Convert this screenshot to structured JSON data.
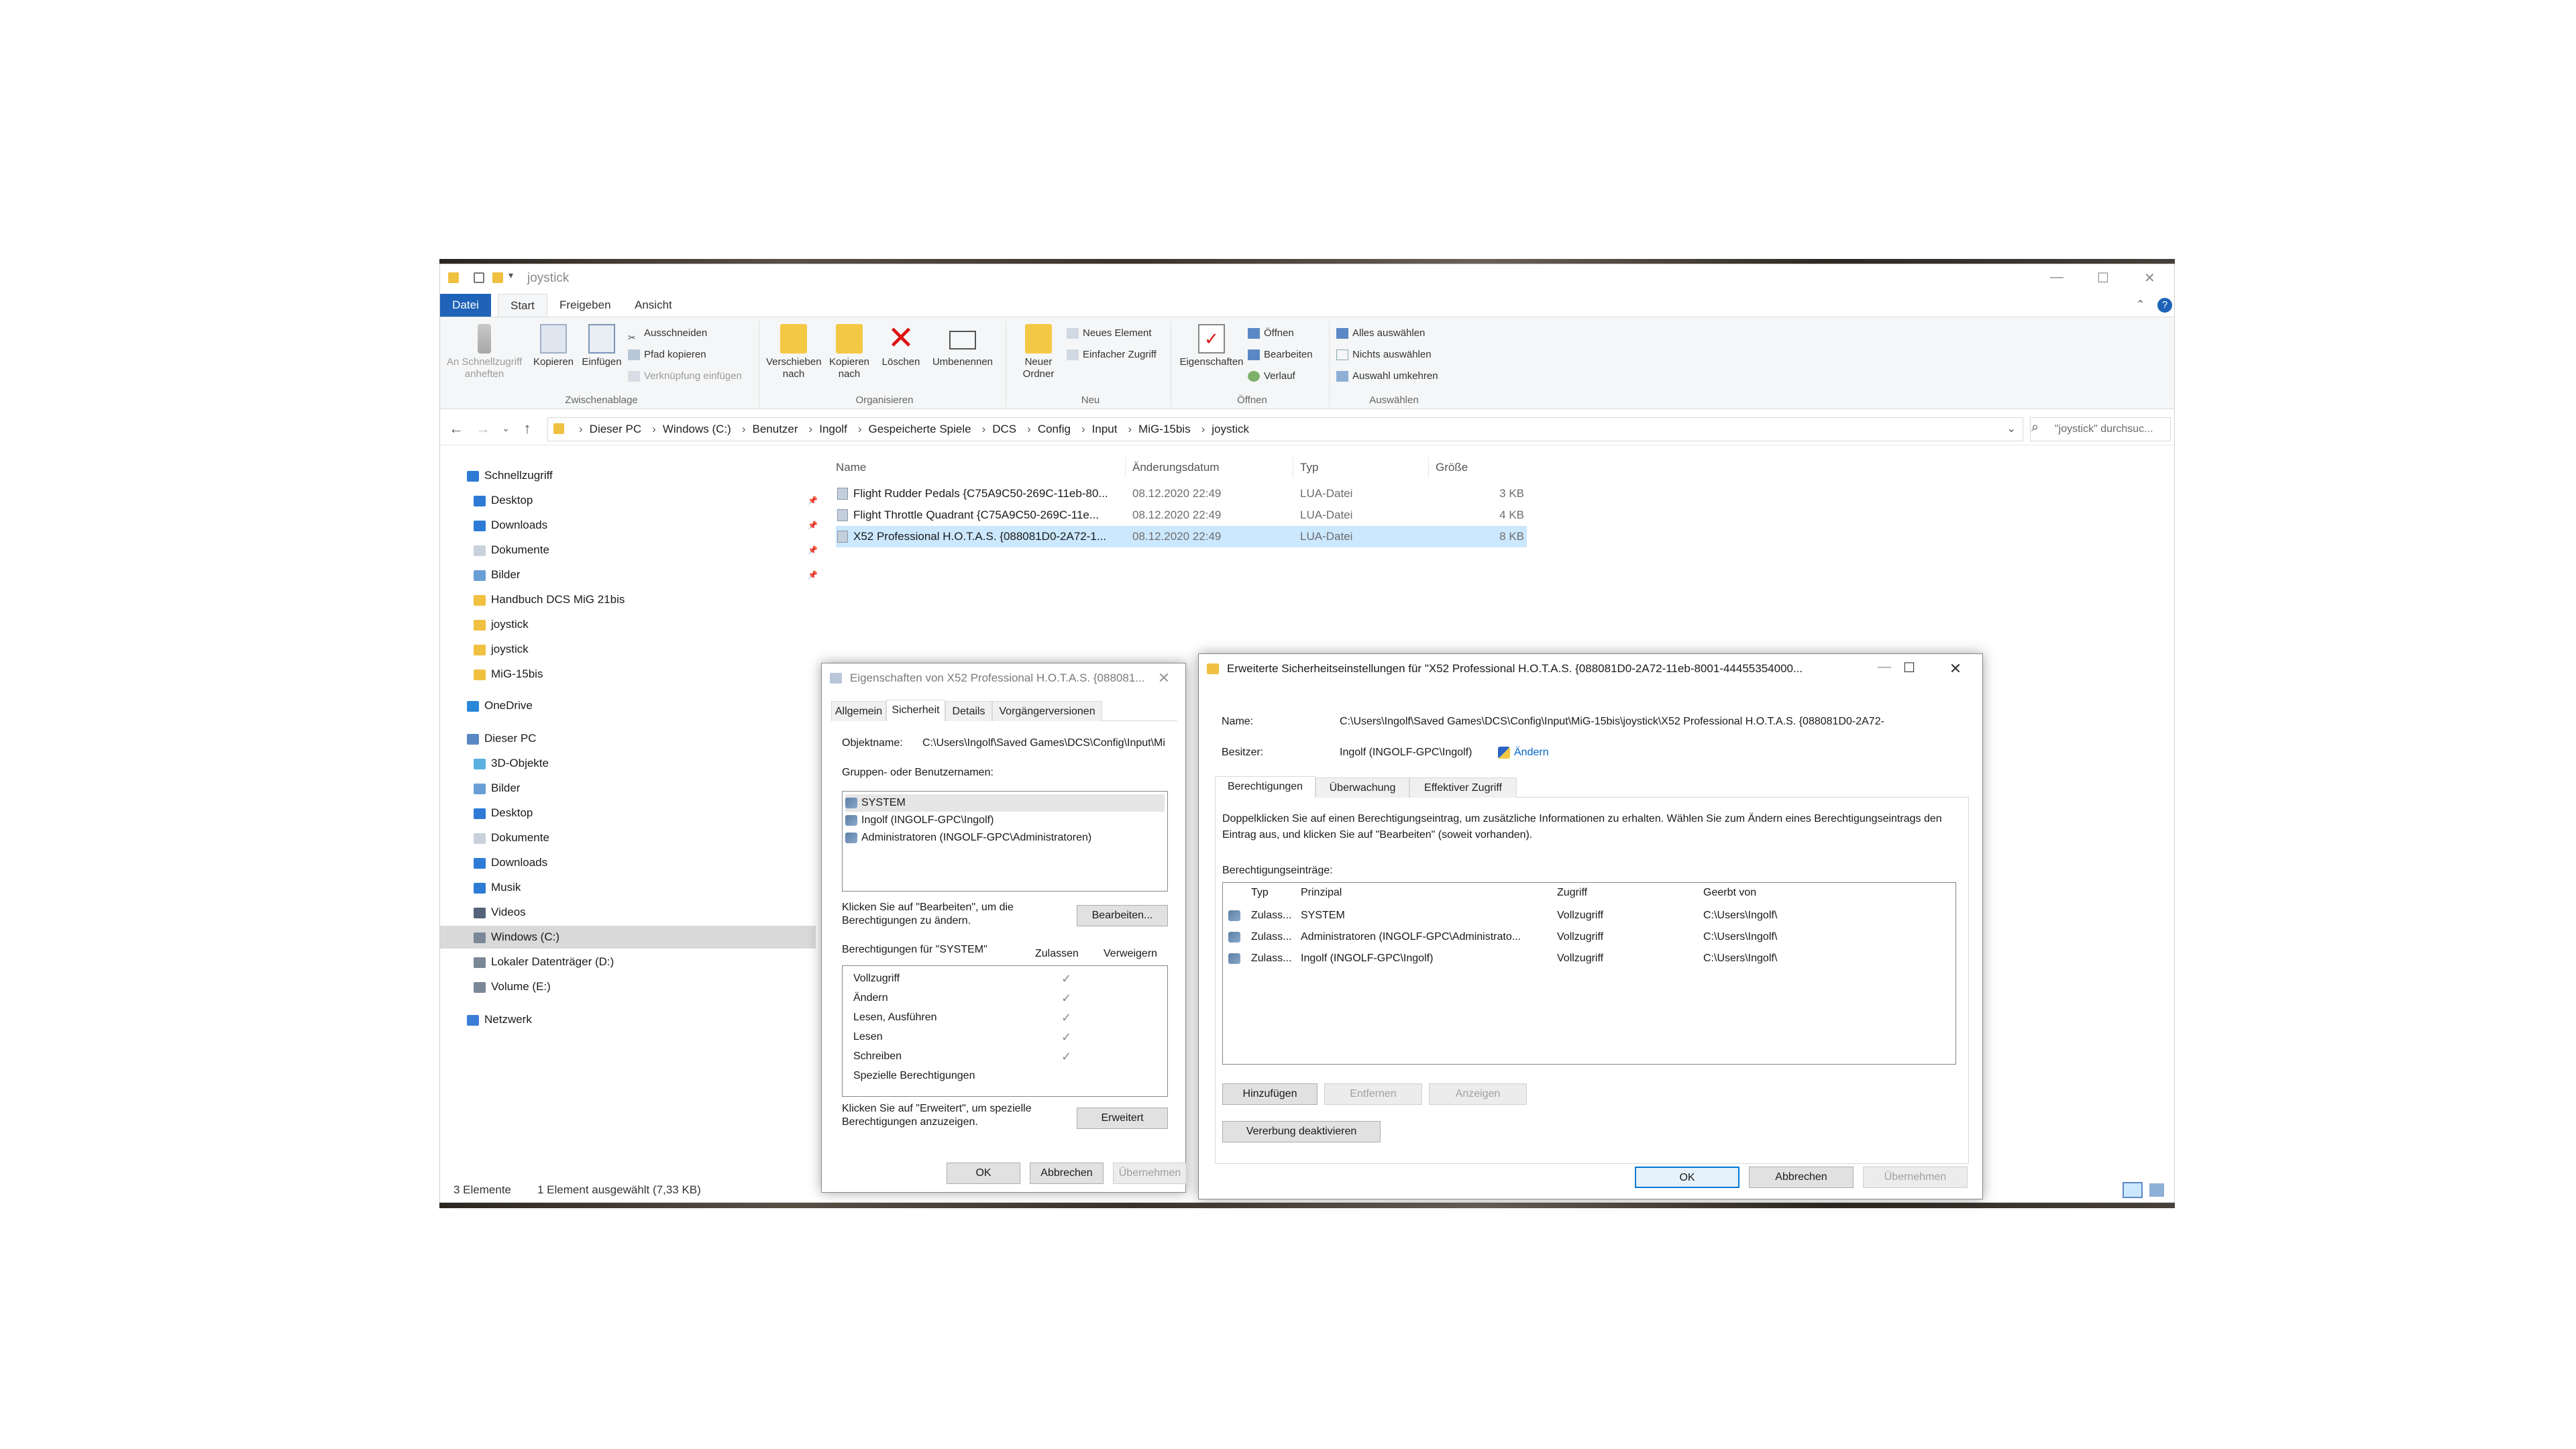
{
  "explorer": {
    "title": "joystick",
    "window_controls": [
      "—",
      "☐",
      "✕"
    ],
    "ribbon_tabs": [
      "Datei",
      "Start",
      "Freigeben",
      "Ansicht"
    ],
    "ribbon": {
      "zwischenablage": {
        "label": "Zwischenablage",
        "pin": "An Schnellzugriff anheften",
        "copy": "Kopieren",
        "paste": "Einfügen",
        "cut": "Ausschneiden",
        "copy_path": "Pfad kopieren",
        "paste_link": "Verknüpfung einfügen"
      },
      "organisieren": {
        "label": "Organisieren",
        "move": "Verschieben nach",
        "copy_to": "Kopieren nach",
        "delete": "Löschen",
        "rename": "Umbenennen"
      },
      "neu": {
        "label": "Neu",
        "new_folder": "Neuer Ordner",
        "new_item": "Neues Element",
        "easy_access": "Einfacher Zugriff"
      },
      "oeffnen": {
        "label": "Öffnen",
        "properties": "Eigenschaften",
        "open": "Öffnen",
        "edit": "Bearbeiten",
        "history": "Verlauf"
      },
      "auswaehlen": {
        "label": "Auswählen",
        "select_all": "Alles auswählen",
        "select_none": "Nichts auswählen",
        "invert": "Auswahl umkehren"
      }
    },
    "breadcrumb": [
      "Dieser PC",
      "Windows (C:)",
      "Benutzer",
      "Ingolf",
      "Gespeicherte Spiele",
      "DCS",
      "Config",
      "Input",
      "MiG-15bis",
      "joystick"
    ],
    "search_placeholder": "\"joystick\" durchsuc...",
    "nav": {
      "quick_access": "Schnellzugriff",
      "quick_items": [
        "Desktop",
        "Downloads",
        "Dokumente",
        "Bilder",
        "Handbuch DCS MiG 21bis",
        "joystick",
        "joystick",
        "MiG-15bis"
      ],
      "onedrive": "OneDrive",
      "this_pc": "Dieser PC",
      "pc_items": [
        "3D-Objekte",
        "Bilder",
        "Desktop",
        "Dokumente",
        "Downloads",
        "Musik",
        "Videos",
        "Windows (C:)",
        "Lokaler Datenträger (D:)",
        "Volume (E:)"
      ],
      "network": "Netzwerk"
    },
    "columns": [
      "Name",
      "Änderungsdatum",
      "Typ",
      "Größe"
    ],
    "files": [
      {
        "name": "Flight Rudder Pedals {C75A9C50-269C-11eb-80...",
        "date": "08.12.2020 22:49",
        "type": "LUA-Datei",
        "size": "3 KB"
      },
      {
        "name": "Flight Throttle Quadrant {C75A9C50-269C-11e...",
        "date": "08.12.2020 22:49",
        "type": "LUA-Datei",
        "size": "4 KB"
      },
      {
        "name": "X52 Professional H.O.T.A.S. {088081D0-2A72-1...",
        "date": "08.12.2020 22:49",
        "type": "LUA-Datei",
        "size": "8 KB"
      }
    ],
    "status": {
      "count": "3 Elemente",
      "selected": "1 Element ausgewählt (7,33 KB)"
    }
  },
  "props_dialog": {
    "title": "Eigenschaften von X52 Professional H.O.T.A.S. {088081...",
    "tabs": [
      "Allgemein",
      "Sicherheit",
      "Details",
      "Vorgängerversionen"
    ],
    "object_label": "Objektname:",
    "object_value": "C:\\Users\\Ingolf\\Saved Games\\DCS\\Config\\Input\\Mi",
    "groups_label": "Gruppen- oder Benutzernamen:",
    "groups": [
      "SYSTEM",
      "Ingolf (INGOLF-GPC\\Ingolf)",
      "Administratoren (INGOLF-GPC\\Administratoren)"
    ],
    "edit_hint": "Klicken Sie auf \"Bearbeiten\", um die Berechtigungen zu ändern.",
    "edit_button": "Bearbeiten...",
    "perms_for": "Berechtigungen für \"SYSTEM\"",
    "allow": "Zulassen",
    "deny": "Verweigern",
    "perms": [
      {
        "name": "Vollzugriff",
        "allow": true
      },
      {
        "name": "Ändern",
        "allow": true
      },
      {
        "name": "Lesen, Ausführen",
        "allow": true
      },
      {
        "name": "Lesen",
        "allow": true
      },
      {
        "name": "Schreiben",
        "allow": true
      },
      {
        "name": "Spezielle Berechtigungen",
        "allow": false
      }
    ],
    "advanced_hint": "Klicken Sie auf \"Erweitert\", um spezielle Berechtigungen anzuzeigen.",
    "advanced_button": "Erweitert",
    "ok": "OK",
    "cancel": "Abbrechen",
    "apply": "Übernehmen"
  },
  "adv_dialog": {
    "title": "Erweiterte Sicherheitseinstellungen für \"X52 Professional H.O.T.A.S. {088081D0-2A72-11eb-8001-44455354000...",
    "name_label": "Name:",
    "name_value": "C:\\Users\\Ingolf\\Saved Games\\DCS\\Config\\Input\\MiG-15bis\\joystick\\X52 Professional H.O.T.A.S. {088081D0-2A72-",
    "owner_label": "Besitzer:",
    "owner_value": "Ingolf (INGOLF-GPC\\Ingolf)",
    "owner_change": "Ändern",
    "tabs": [
      "Berechtigungen",
      "Überwachung",
      "Effektiver Zugriff"
    ],
    "info": "Doppelklicken Sie auf einen Berechtigungseintrag, um zusätzliche Informationen zu erhalten. Wählen Sie zum Ändern eines Berechtigungseintrags den Eintrag aus, und klicken Sie auf \"Bearbeiten\" (soweit vorhanden).",
    "entries_label": "Berechtigungseinträge:",
    "columns": [
      "Typ",
      "Prinzipal",
      "Zugriff",
      "Geerbt von"
    ],
    "entries": [
      {
        "type": "Zulass...",
        "principal": "SYSTEM",
        "access": "Vollzugriff",
        "inherited": "C:\\Users\\Ingolf\\"
      },
      {
        "type": "Zulass...",
        "principal": "Administratoren (INGOLF-GPC\\Administrato...",
        "access": "Vollzugriff",
        "inherited": "C:\\Users\\Ingolf\\"
      },
      {
        "type": "Zulass...",
        "principal": "Ingolf (INGOLF-GPC\\Ingolf)",
        "access": "Vollzugriff",
        "inherited": "C:\\Users\\Ingolf\\"
      }
    ],
    "add": "Hinzufügen",
    "remove": "Entfernen",
    "view": "Anzeigen",
    "disable_inheritance": "Vererbung deaktivieren",
    "ok": "OK",
    "cancel": "Abbrechen",
    "apply": "Übernehmen"
  }
}
